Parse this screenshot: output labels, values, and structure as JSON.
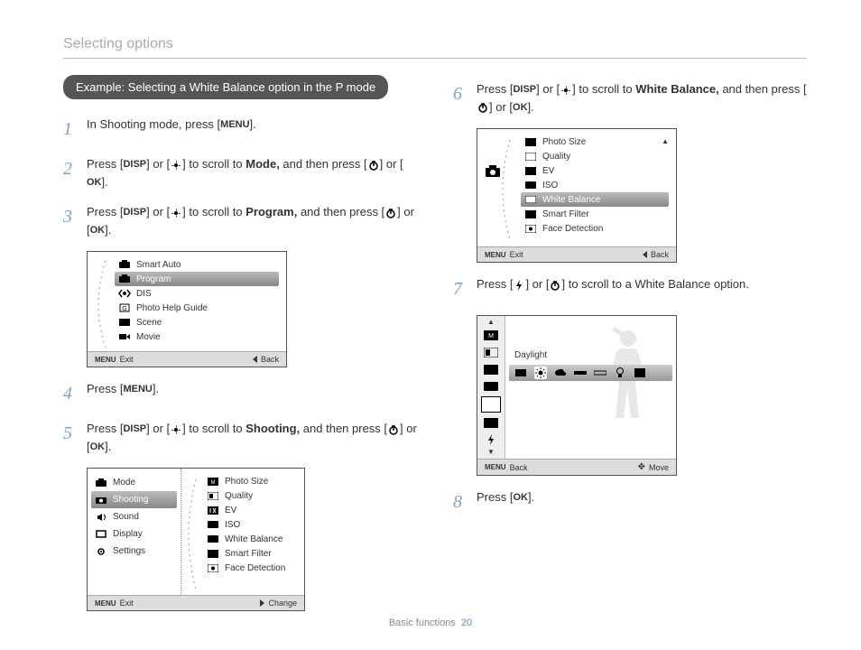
{
  "section_title": "Selecting options",
  "callout": "Example: Selecting a White Balance option in the P mode",
  "buttons": {
    "menu": "MENU",
    "disp": "DISP",
    "ok": "OK"
  },
  "steps": {
    "s1_a": "In Shooting mode, press [",
    "s1_b": "].",
    "s2_a": "Press [",
    "s2_b": "] or [",
    "s2_c": "] to scroll to ",
    "s2_bold": "Mode,",
    "s2_d": " and then press [",
    "s2_e": "] or [",
    "s2_f": "].",
    "s3_a": "Press [",
    "s3_b": "] or [",
    "s3_c": "] to scroll to ",
    "s3_bold": "Program,",
    "s3_d": " and then press [",
    "s3_e": "] or [",
    "s3_f": "].",
    "s4_a": "Press [",
    "s4_b": "].",
    "s5_a": "Press [",
    "s5_b": "] or [",
    "s5_c": "] to scroll to ",
    "s5_bold": "Shooting,",
    "s5_d": " and then press [",
    "s5_e": "] or [",
    "s5_f": "].",
    "s6_a": "Press [",
    "s6_b": "] or [",
    "s6_c": "] to scroll to ",
    "s6_bold": "White Balance,",
    "s6_d": " and then press [",
    "s6_e": "] or [",
    "s6_f": "].",
    "s7_a": "Press [",
    "s7_b": "] or [",
    "s7_c": "] to scroll to a White Balance option.",
    "s8_a": "Press [",
    "s8_b": "]."
  },
  "nums": {
    "n1": "1",
    "n2": "2",
    "n3": "3",
    "n4": "4",
    "n5": "5",
    "n6": "6",
    "n7": "7",
    "n8": "8"
  },
  "shot1": {
    "items": [
      "Smart Auto",
      "Program",
      "DIS",
      "Photo Help Guide",
      "Scene",
      "Movie"
    ],
    "bar_left": "Exit",
    "bar_right": "Back"
  },
  "shot2": {
    "left": [
      "Mode",
      "Shooting",
      "Sound",
      "Display",
      "Settings"
    ],
    "right": [
      "Photo Size",
      "Quality",
      "EV",
      "ISO",
      "White Balance",
      "Smart Filter",
      "Face Detection"
    ],
    "bar_left": "Exit",
    "bar_right": "Change"
  },
  "shot3": {
    "items": [
      "Photo Size",
      "Quality",
      "EV",
      "ISO",
      "White Balance",
      "Smart Filter",
      "Face Detection"
    ],
    "bar_left": "Exit",
    "bar_right": "Back"
  },
  "shot4": {
    "label": "Daylight",
    "bar_left": "Back",
    "bar_right": "Move"
  },
  "footer": {
    "label": "Basic functions",
    "page": "20"
  }
}
